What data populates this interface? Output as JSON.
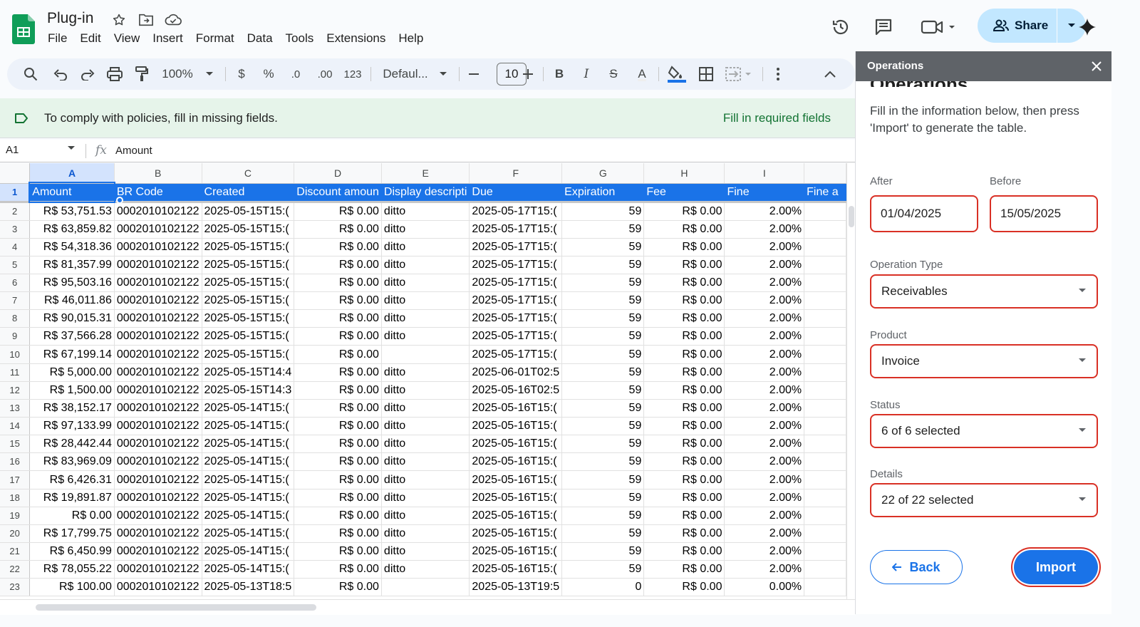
{
  "app": {
    "doc_title": "Plug-in",
    "menu": [
      "File",
      "Edit",
      "View",
      "Insert",
      "Format",
      "Data",
      "Tools",
      "Extensions",
      "Help"
    ],
    "share_label": "Share",
    "icons": [
      "star-icon",
      "move-icon",
      "cloud-status-icon",
      "history-icon",
      "comments-icon",
      "meet-icon",
      "gemini-icon"
    ]
  },
  "toolbar": {
    "zoom": "100%",
    "currency": "$",
    "percent": "%",
    "decrease_decimal": ".0",
    "increase_decimal": ".00",
    "number_format": "123",
    "font_family": "Defaul...",
    "font_size": "10",
    "bold": "B",
    "italic": "I",
    "strike": "S",
    "text_color": "A"
  },
  "banner": {
    "message": "To comply with policies, fill in missing fields.",
    "action": "Fill in required fields"
  },
  "formula_bar": {
    "cell_ref": "A1",
    "fx": "fx",
    "content": "Amount"
  },
  "sheet": {
    "columns": [
      "A",
      "B",
      "C",
      "D",
      "E",
      "F",
      "G",
      "H",
      "I",
      ""
    ],
    "headers": [
      "Amount",
      "BR Code",
      "Created",
      "Discount amoun",
      "Display descripti",
      "Due",
      "Expiration",
      "Fee",
      "Fine",
      "Fine a"
    ],
    "rows": [
      {
        "n": "2",
        "cells": [
          "R$ 53,751.53",
          "0002010102122",
          "2025-05-15T15:(",
          "R$ 0.00",
          "ditto",
          "2025-05-17T15:(",
          "59",
          "R$ 0.00",
          "2.00%",
          ""
        ]
      },
      {
        "n": "3",
        "cells": [
          "R$ 63,859.82",
          "0002010102122",
          "2025-05-15T15:(",
          "R$ 0.00",
          "ditto",
          "2025-05-17T15:(",
          "59",
          "R$ 0.00",
          "2.00%",
          ""
        ]
      },
      {
        "n": "4",
        "cells": [
          "R$ 54,318.36",
          "0002010102122",
          "2025-05-15T15:(",
          "R$ 0.00",
          "ditto",
          "2025-05-17T15:(",
          "59",
          "R$ 0.00",
          "2.00%",
          ""
        ]
      },
      {
        "n": "5",
        "cells": [
          "R$ 81,357.99",
          "0002010102122",
          "2025-05-15T15:(",
          "R$ 0.00",
          "ditto",
          "2025-05-17T15:(",
          "59",
          "R$ 0.00",
          "2.00%",
          ""
        ]
      },
      {
        "n": "6",
        "cells": [
          "R$ 95,503.16",
          "0002010102122",
          "2025-05-15T15:(",
          "R$ 0.00",
          "ditto",
          "2025-05-17T15:(",
          "59",
          "R$ 0.00",
          "2.00%",
          ""
        ]
      },
      {
        "n": "7",
        "cells": [
          "R$ 46,011.86",
          "0002010102122",
          "2025-05-15T15:(",
          "R$ 0.00",
          "ditto",
          "2025-05-17T15:(",
          "59",
          "R$ 0.00",
          "2.00%",
          ""
        ]
      },
      {
        "n": "8",
        "cells": [
          "R$ 90,015.31",
          "0002010102122",
          "2025-05-15T15:(",
          "R$ 0.00",
          "ditto",
          "2025-05-17T15:(",
          "59",
          "R$ 0.00",
          "2.00%",
          ""
        ]
      },
      {
        "n": "9",
        "cells": [
          "R$ 37,566.28",
          "0002010102122",
          "2025-05-15T15:(",
          "R$ 0.00",
          "ditto",
          "2025-05-17T15:(",
          "59",
          "R$ 0.00",
          "2.00%",
          ""
        ]
      },
      {
        "n": "10",
        "cells": [
          "R$ 67,199.14",
          "0002010102122",
          "2025-05-15T15:(",
          "R$ 0.00",
          "",
          "2025-05-17T15:(",
          "59",
          "R$ 0.00",
          "2.00%",
          ""
        ]
      },
      {
        "n": "11",
        "cells": [
          "R$ 5,000.00",
          "0002010102122",
          "2025-05-15T14:4",
          "R$ 0.00",
          "ditto",
          "2025-06-01T02:5",
          "59",
          "R$ 0.00",
          "2.00%",
          ""
        ]
      },
      {
        "n": "12",
        "cells": [
          "R$ 1,500.00",
          "0002010102122",
          "2025-05-15T14:3",
          "R$ 0.00",
          "ditto",
          "2025-05-16T02:5",
          "59",
          "R$ 0.00",
          "2.00%",
          ""
        ]
      },
      {
        "n": "13",
        "cells": [
          "R$ 38,152.17",
          "0002010102122",
          "2025-05-14T15:(",
          "R$ 0.00",
          "ditto",
          "2025-05-16T15:(",
          "59",
          "R$ 0.00",
          "2.00%",
          ""
        ]
      },
      {
        "n": "14",
        "cells": [
          "R$ 97,133.99",
          "0002010102122",
          "2025-05-14T15:(",
          "R$ 0.00",
          "ditto",
          "2025-05-16T15:(",
          "59",
          "R$ 0.00",
          "2.00%",
          ""
        ]
      },
      {
        "n": "15",
        "cells": [
          "R$ 28,442.44",
          "0002010102122",
          "2025-05-14T15:(",
          "R$ 0.00",
          "ditto",
          "2025-05-16T15:(",
          "59",
          "R$ 0.00",
          "2.00%",
          ""
        ]
      },
      {
        "n": "16",
        "cells": [
          "R$ 83,969.09",
          "0002010102122",
          "2025-05-14T15:(",
          "R$ 0.00",
          "ditto",
          "2025-05-16T15:(",
          "59",
          "R$ 0.00",
          "2.00%",
          ""
        ]
      },
      {
        "n": "17",
        "cells": [
          "R$ 6,426.31",
          "0002010102122",
          "2025-05-14T15:(",
          "R$ 0.00",
          "ditto",
          "2025-05-16T15:(",
          "59",
          "R$ 0.00",
          "2.00%",
          ""
        ]
      },
      {
        "n": "18",
        "cells": [
          "R$ 19,891.87",
          "0002010102122",
          "2025-05-14T15:(",
          "R$ 0.00",
          "ditto",
          "2025-05-16T15:(",
          "59",
          "R$ 0.00",
          "2.00%",
          ""
        ]
      },
      {
        "n": "19",
        "cells": [
          "R$ 0.00",
          "0002010102122",
          "2025-05-14T15:(",
          "R$ 0.00",
          "ditto",
          "2025-05-16T15:(",
          "59",
          "R$ 0.00",
          "2.00%",
          ""
        ]
      },
      {
        "n": "20",
        "cells": [
          "R$ 17,799.75",
          "0002010102122",
          "2025-05-14T15:(",
          "R$ 0.00",
          "ditto",
          "2025-05-16T15:(",
          "59",
          "R$ 0.00",
          "2.00%",
          ""
        ]
      },
      {
        "n": "21",
        "cells": [
          "R$ 6,450.99",
          "0002010102122",
          "2025-05-14T15:(",
          "R$ 0.00",
          "ditto",
          "2025-05-16T15:(",
          "59",
          "R$ 0.00",
          "2.00%",
          ""
        ]
      },
      {
        "n": "22",
        "cells": [
          "R$ 78,055.22",
          "0002010102122",
          "2025-05-14T15:(",
          "R$ 0.00",
          "ditto",
          "2025-05-16T15:(",
          "59",
          "R$ 0.00",
          "2.00%",
          ""
        ]
      },
      {
        "n": "23",
        "cells": [
          "R$ 100.00",
          "0002010102122",
          "2025-05-13T18:5",
          "R$ 0.00",
          "",
          "2025-05-13T19:5",
          "0",
          "R$ 0.00",
          "0.00%",
          ""
        ]
      }
    ]
  },
  "panel": {
    "title": "Operations",
    "heading": "Operations",
    "description": "Fill in the information below, then press 'Import' to generate the table.",
    "after_label": "After",
    "after_value": "01/04/2025",
    "before_label": "Before",
    "before_value": "15/05/2025",
    "operation_type_label": "Operation Type",
    "operation_type_value": "Receivables",
    "product_label": "Product",
    "product_value": "Invoice",
    "status_label": "Status",
    "status_value": "6 of 6 selected",
    "details_label": "Details",
    "details_value": "22 of 22 selected",
    "back_label": "Back",
    "import_label": "Import"
  },
  "colors": {
    "accent": "#1a73e8",
    "error_border": "#d93025",
    "banner_bg": "#e6f4ea",
    "banner_action": "#137333",
    "share_bg": "#c2e7ff"
  }
}
